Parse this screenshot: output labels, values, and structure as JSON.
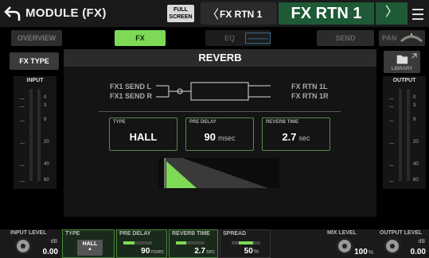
{
  "header": {
    "title": "MODULE (FX)",
    "full_screen_line1": "FULL",
    "full_screen_line2": "SCREEN",
    "prev_channel": "FX RTN 1",
    "channel_name": "FX RTN 1",
    "back_icon": "back-arrow-icon",
    "next_icon": "chevron-right-icon",
    "menu_icon": "hamburger-menu-icon"
  },
  "tabs": {
    "overview": "OVERVIEW",
    "fx": "FX",
    "eq": "EQ",
    "send": "SEND",
    "pan": "PAN"
  },
  "side_buttons": {
    "fx_type": "FX TYPE",
    "library": "LIBRARY"
  },
  "effect": {
    "name": "REVERB",
    "inputs": [
      "FX1 SEND L",
      "FX1 SEND R"
    ],
    "outputs": [
      "FX RTN 1L",
      "FX RTN 1R"
    ],
    "params": [
      {
        "label": "TYPE",
        "value": "HALL",
        "unit": ""
      },
      {
        "label": "PRE DELAY",
        "value": "90",
        "unit": "msec"
      },
      {
        "label": "REVERB TIME",
        "value": "2.7",
        "unit": "sec"
      }
    ]
  },
  "meters": {
    "input_title": "INPUT",
    "output_title": "OUTPUT",
    "scale": [
      "0",
      "3",
      "9",
      "20",
      "40",
      "60"
    ]
  },
  "bottom": {
    "input_level": {
      "label": "INPUT LEVEL",
      "unit": "dB",
      "value": "0.00"
    },
    "type": {
      "label": "TYPE",
      "value": "HALL"
    },
    "pre_delay": {
      "label": "PRE DELAY",
      "value": "90",
      "unit": "msec"
    },
    "reverb_time": {
      "label": "REVERB TIME",
      "value": "2.7",
      "unit": "sec"
    },
    "spread": {
      "label": "SPREAD",
      "value": "50",
      "unit": "%"
    },
    "mix_level": {
      "label": "MIX LEVEL",
      "value": "100",
      "unit": "%"
    },
    "output_level": {
      "label": "OUTPUT LEVEL",
      "unit": "dB",
      "value": "0.00"
    }
  },
  "colors": {
    "accent_green": "#7ed957",
    "channel_green": "#1f5a36"
  }
}
